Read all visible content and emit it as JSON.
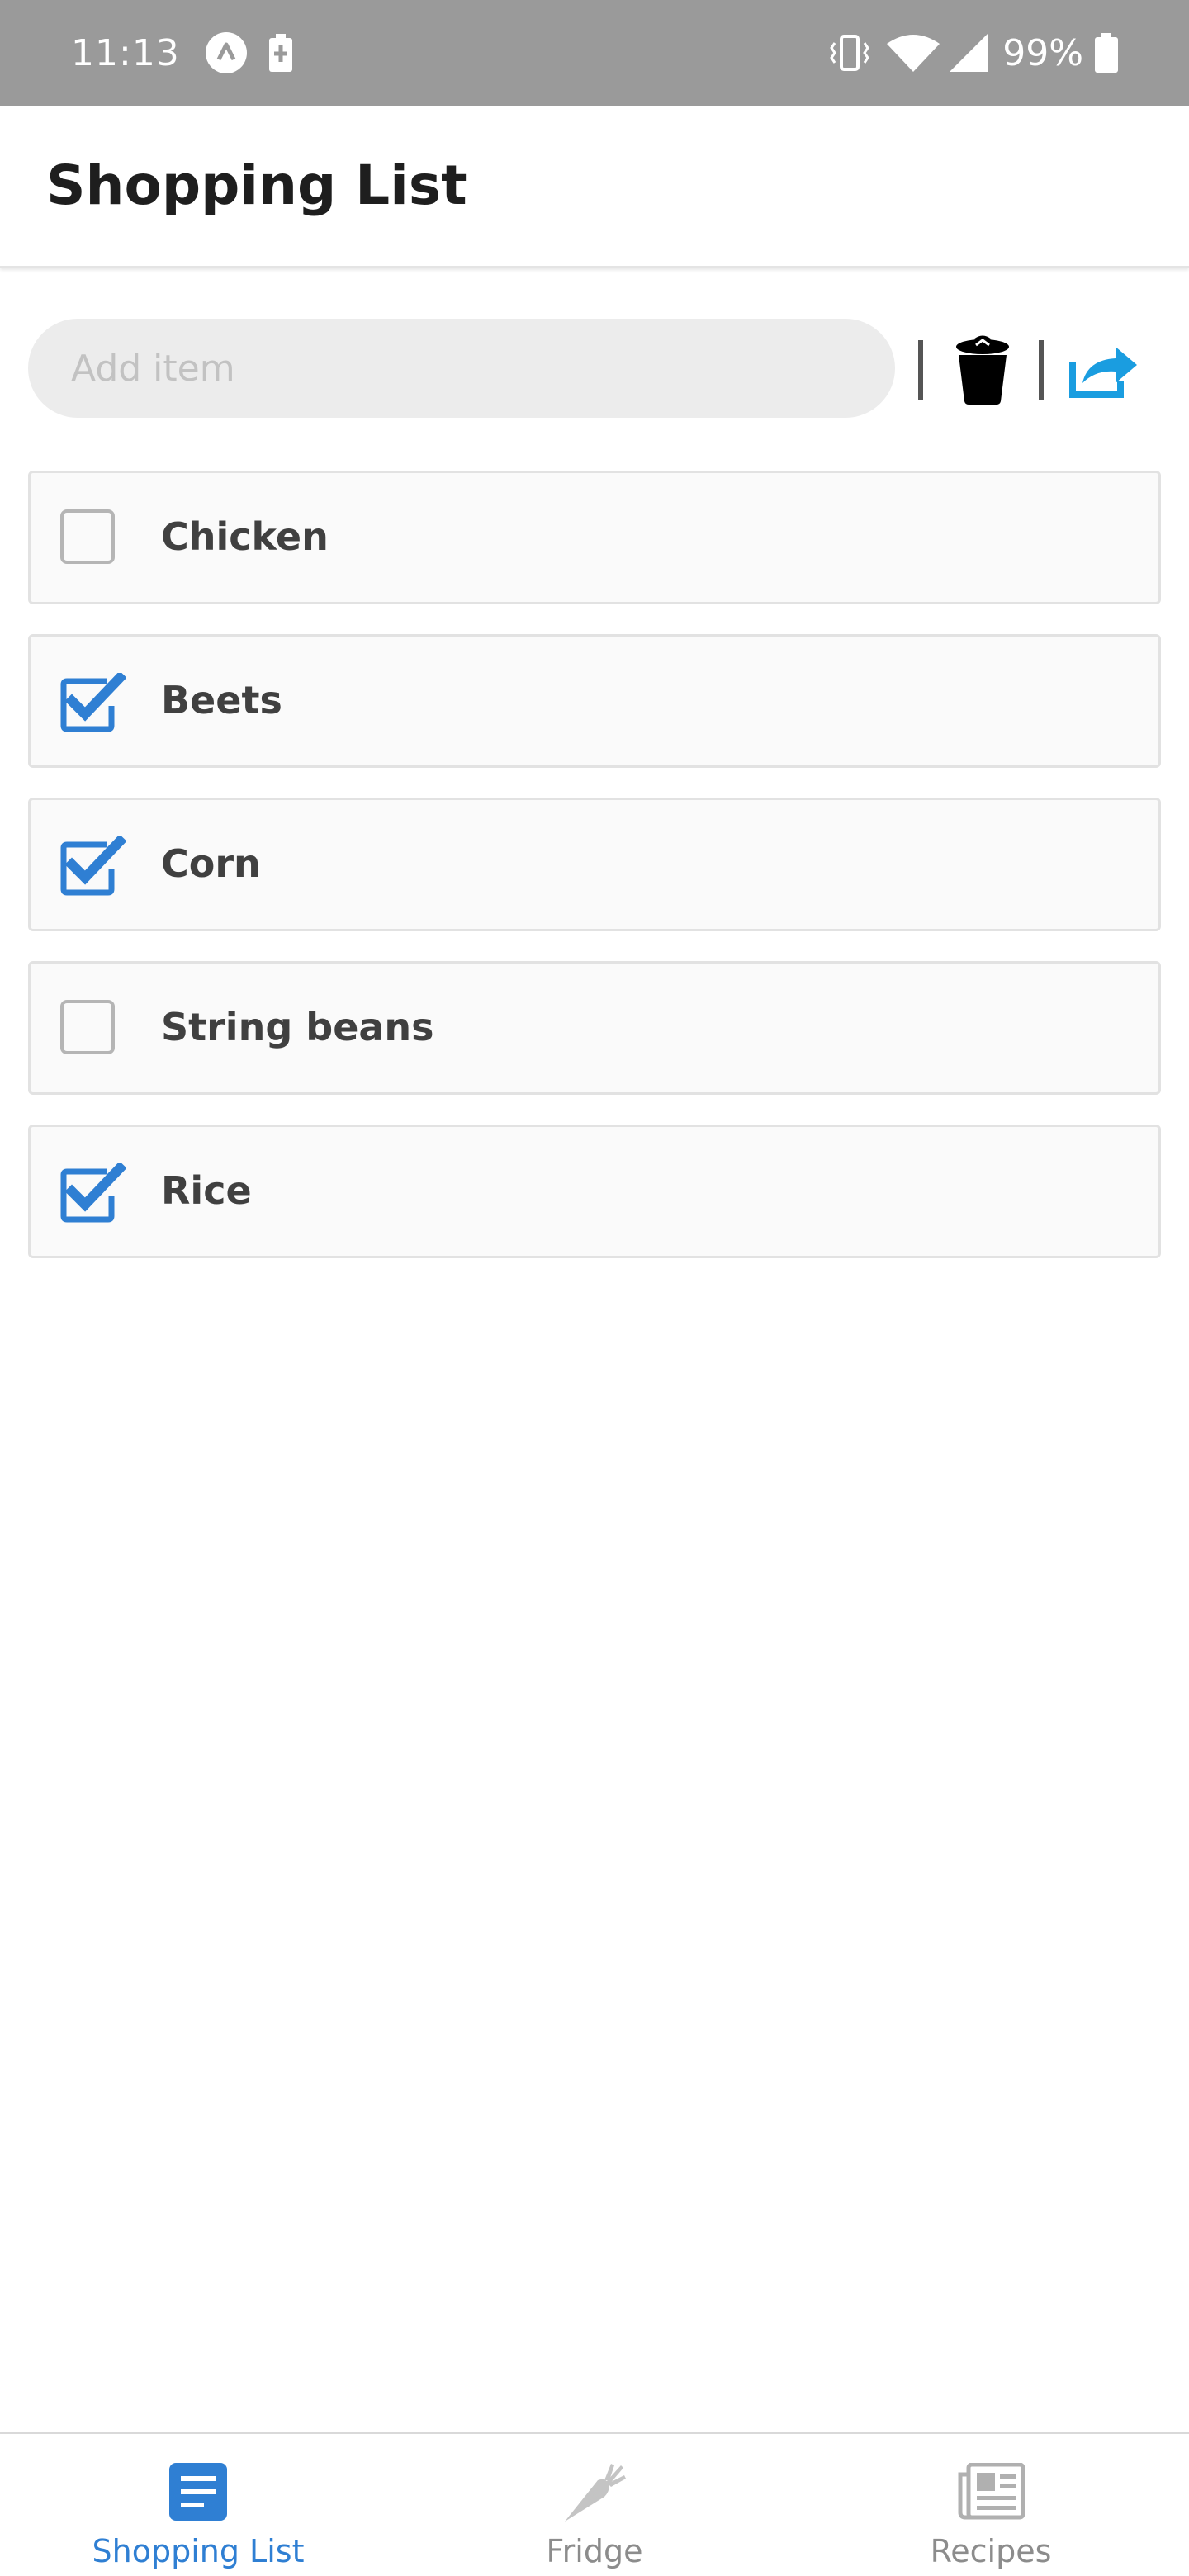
{
  "status_bar": {
    "time": "11:13",
    "battery_percent": "99%",
    "icons": [
      "app-notification-icon",
      "battery-charging-icon",
      "vibrate-icon",
      "wifi-icon",
      "signal-icon",
      "battery-icon"
    ]
  },
  "header": {
    "title": "Shopping List"
  },
  "add_item": {
    "placeholder": "Add item",
    "value": "",
    "actions": [
      "trash-icon",
      "share-icon"
    ]
  },
  "items": [
    {
      "label": "Chicken",
      "checked": false
    },
    {
      "label": "Beets",
      "checked": true
    },
    {
      "label": "Corn",
      "checked": true
    },
    {
      "label": "String beans",
      "checked": false
    },
    {
      "label": "Rice",
      "checked": true
    }
  ],
  "bottom_nav": {
    "tabs": [
      {
        "label": "Shopping List",
        "icon": "list-document-icon",
        "active": true
      },
      {
        "label": "Fridge",
        "icon": "carrot-icon",
        "active": false
      },
      {
        "label": "Recipes",
        "icon": "newspaper-icon",
        "active": false
      }
    ]
  },
  "colors": {
    "accent": "#2f7fd3",
    "share": "#1a9de0",
    "status_bar": "#9a9a9a",
    "inactive": "#8c8c8c"
  }
}
